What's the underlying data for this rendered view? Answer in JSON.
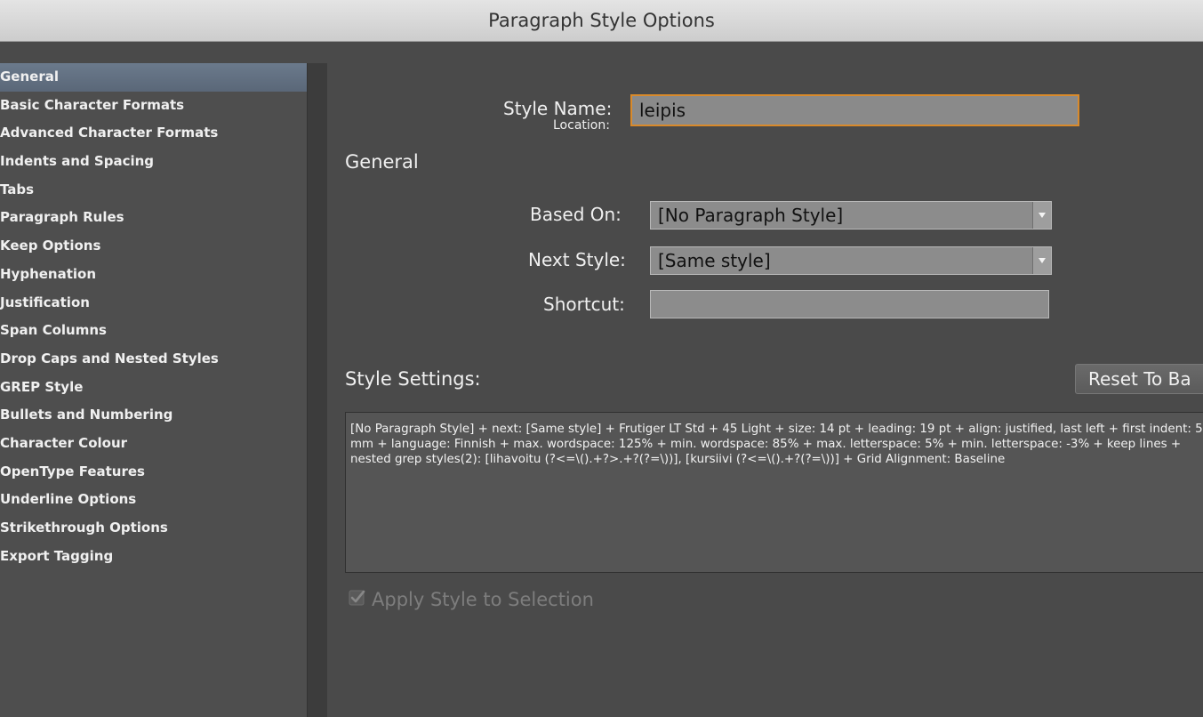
{
  "window": {
    "title": "Paragraph Style Options"
  },
  "sidebar": {
    "items": [
      {
        "label": "General",
        "active": true
      },
      {
        "label": "Basic Character Formats"
      },
      {
        "label": "Advanced Character Formats"
      },
      {
        "label": "Indents and Spacing"
      },
      {
        "label": "Tabs"
      },
      {
        "label": "Paragraph Rules"
      },
      {
        "label": "Keep Options"
      },
      {
        "label": "Hyphenation"
      },
      {
        "label": "Justification"
      },
      {
        "label": "Span Columns"
      },
      {
        "label": "Drop Caps and Nested Styles"
      },
      {
        "label": "GREP Style"
      },
      {
        "label": "Bullets and Numbering"
      },
      {
        "label": "Character Colour"
      },
      {
        "label": "OpenType Features"
      },
      {
        "label": "Underline Options"
      },
      {
        "label": "Strikethrough Options"
      },
      {
        "label": "Export Tagging"
      }
    ]
  },
  "main": {
    "style_name_label": "Style Name:",
    "style_name_value": "leipis",
    "location_label": "Location:",
    "section_heading": "General",
    "based_on_label": "Based On:",
    "based_on_value": "[No Paragraph Style]",
    "next_style_label": "Next Style:",
    "next_style_value": "[Same style]",
    "shortcut_label": "Shortcut:",
    "shortcut_value": "",
    "style_settings_label": "Style Settings:",
    "reset_button_label": "Reset To Ba",
    "style_settings_text": "[No Paragraph Style] + next: [Same style] + Frutiger LT Std + 45 Light + size: 14 pt + leading: 19 pt + align: justified, last left + first indent: 5 mm + language: Finnish + max. wordspace: 125% + min. wordspace: 85% + max. letterspace: 5% + min. letterspace: -3% + keep lines + nested grep styles(2): [lihavoitu (?<=\\().+?>.+?(?=\\))], [kursiivi (?<=\\().+?(?=\\))] + Grid Alignment:  Baseline",
    "apply_label": "Apply Style to Selection",
    "apply_checked": true,
    "apply_enabled": false
  },
  "colors": {
    "background": "#4a4a4a",
    "selected_item": "#5e6b7c",
    "focus_ring": "#d98a2b"
  }
}
